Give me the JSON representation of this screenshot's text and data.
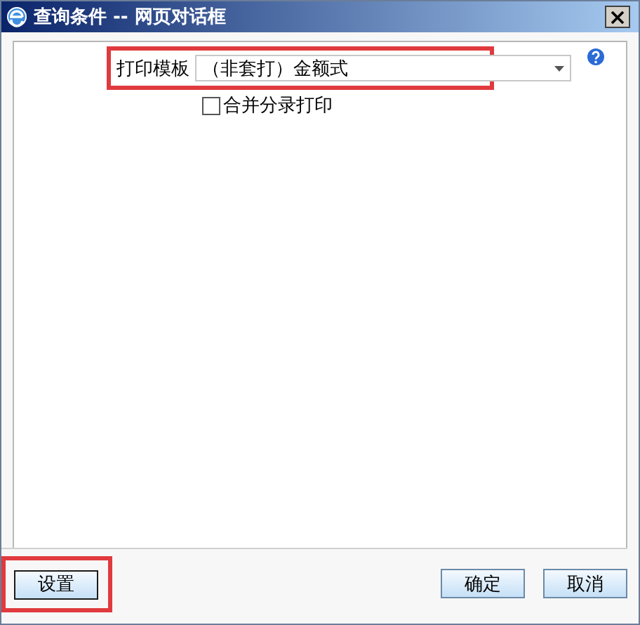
{
  "window": {
    "title": "查询条件 -- 网页对话框"
  },
  "print_template": {
    "label": "打印模板",
    "value": "（非套打）金额式",
    "highlighted": true
  },
  "merge_print": {
    "label": "合并分录打印",
    "checked": false
  },
  "settings_button": {
    "label": "设置",
    "highlighted": true
  },
  "buttons": [
    {
      "label": "确定"
    },
    {
      "label": "取消"
    }
  ]
}
